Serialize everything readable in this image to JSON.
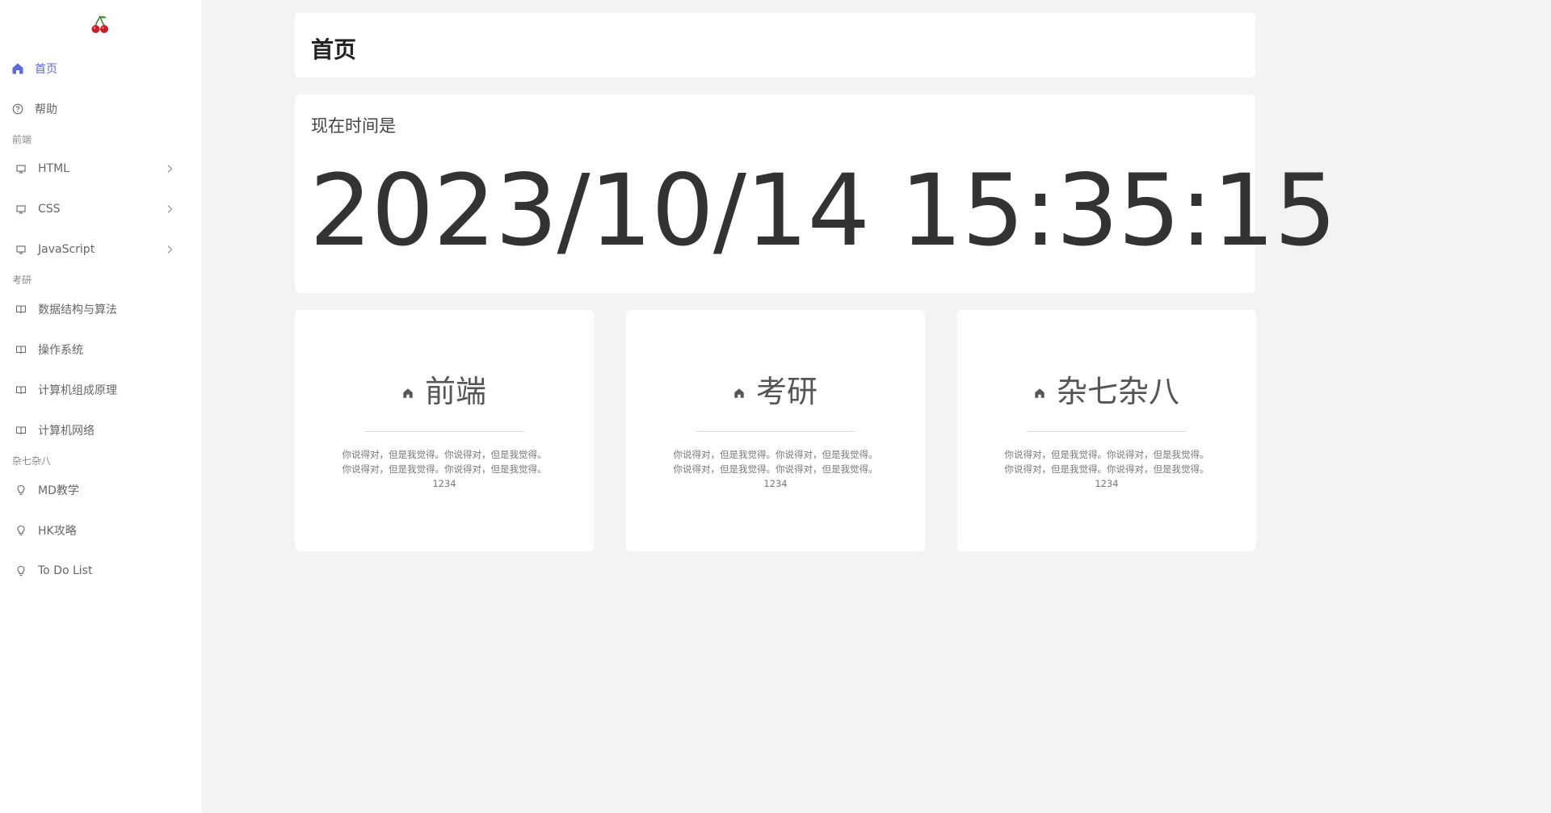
{
  "sidebar": {
    "logo": "cherry-logo",
    "top_items": [
      {
        "label": "首页",
        "icon": "home-icon",
        "active": true
      },
      {
        "label": "帮助",
        "icon": "question-circle-icon",
        "active": false
      }
    ],
    "groups": [
      {
        "title": "前端",
        "items": [
          {
            "label": "HTML",
            "icon": "monitor-icon",
            "expandable": true
          },
          {
            "label": "CSS",
            "icon": "monitor-icon",
            "expandable": true
          },
          {
            "label": "JavaScript",
            "icon": "monitor-icon",
            "expandable": true
          }
        ]
      },
      {
        "title": "考研",
        "items": [
          {
            "label": "数据结构与算法",
            "icon": "book-icon"
          },
          {
            "label": "操作系统",
            "icon": "book-icon"
          },
          {
            "label": "计算机组成原理",
            "icon": "book-icon"
          },
          {
            "label": "计算机网络",
            "icon": "book-icon"
          }
        ]
      },
      {
        "title": "杂七杂八",
        "items": [
          {
            "label": "MD教学",
            "icon": "bulb-icon"
          },
          {
            "label": "HK攻略",
            "icon": "bulb-icon"
          },
          {
            "label": "To Do List",
            "icon": "bulb-icon"
          }
        ]
      }
    ]
  },
  "header": {
    "title": "首页"
  },
  "clock": {
    "label": "现在时间是",
    "value": "2023/10/14 15:35:15"
  },
  "categories": [
    {
      "title": "前端",
      "icon": "home-icon",
      "description": "你说得对，但是我觉得。你说得对，但是我觉得。你说得对，但是我觉得。你说得对，但是我觉得。1234"
    },
    {
      "title": "考研",
      "icon": "home-icon",
      "description": "你说得对，但是我觉得。你说得对，但是我觉得。你说得对，但是我觉得。你说得对，但是我觉得。1234"
    },
    {
      "title": "杂七杂八",
      "icon": "home-icon",
      "description": "你说得对，但是我觉得。你说得对，但是我觉得。你说得对，但是我觉得。你说得对，但是我觉得。1234"
    }
  ],
  "colors": {
    "accent": "#5b6cd9",
    "background": "#f3f3f3",
    "card": "#ffffff"
  }
}
